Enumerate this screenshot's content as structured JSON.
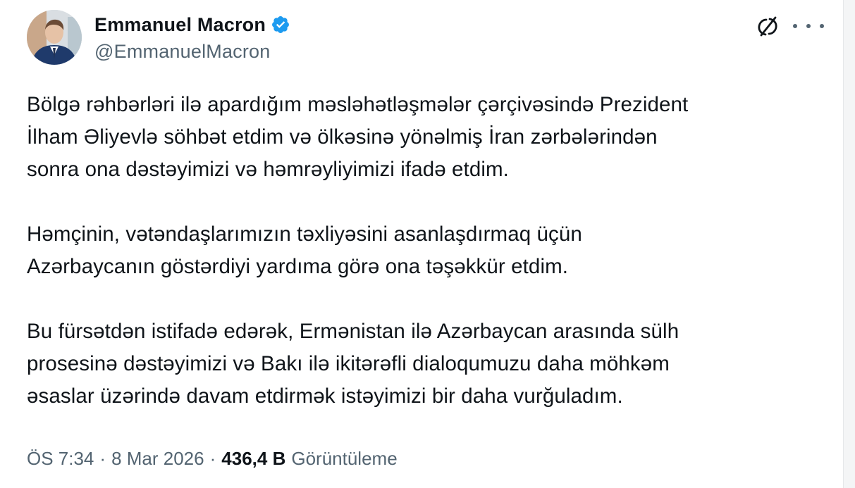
{
  "author": {
    "display_name": "Emmanuel Macron",
    "handle": "@EmmanuelMacron",
    "verified": true,
    "verified_color": "#1d9bf0"
  },
  "tweet": {
    "paragraphs": [
      {
        "lines": [
          "Bölgə rəhbərləri ilə apardığım məsləhətləşmələr çərçivəsində Prezident",
          "İlham Əliyevlə söhbət etdim və ölkəsinə yönəlmiş İran zərbələrindən",
          "sonra ona dəstəyimizi və həmrəyliyimizi ifadə etdim."
        ]
      },
      {
        "lines": [
          "Həmçinin, vətəndaşlarımızın təxliyəsini asanlaşdırmaq üçün",
          "Azərbaycanın göstərdiyi yardıma görə ona təşəkkür etdim."
        ]
      },
      {
        "lines": [
          "Bu fürsətdən istifadə edərək, Ermənistan ilə Azərbaycan arasında sülh",
          "prosesinə dəstəyimizi və Bakı ilə ikitərəfli dialoqumuzu daha möhkəm",
          "əsaslar üzərində davam etdirmək istəyimizi bir daha vurğuladım."
        ]
      }
    ]
  },
  "meta": {
    "time": "ÖS 7:34",
    "separator": "·",
    "date": "8 Mar 2026",
    "views_count": "436,4 B",
    "views_label": "Görüntüleme"
  },
  "icons": {
    "grok": "grok-icon",
    "more": "more-options-icon",
    "verified": "verified-badge-icon"
  },
  "colors": {
    "text_primary": "#0f1419",
    "text_secondary": "#536471",
    "background": "#ffffff"
  }
}
